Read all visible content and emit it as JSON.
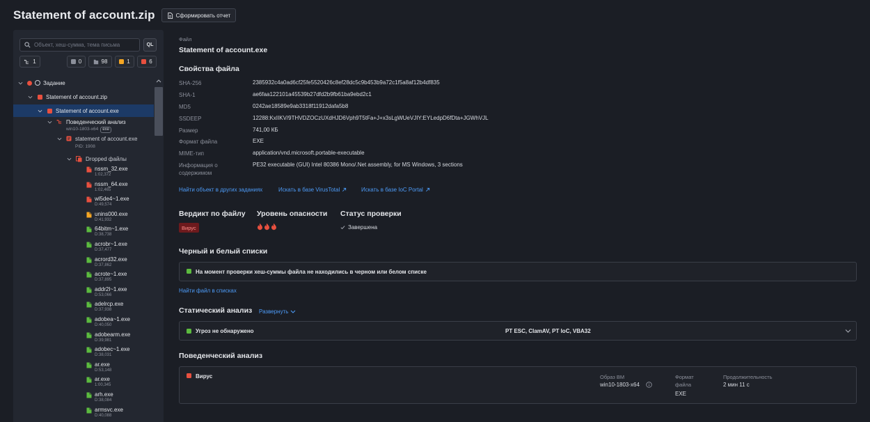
{
  "header": {
    "title": "Statement of account.zip",
    "report_button": "Сформировать отчет"
  },
  "sidebar": {
    "search_placeholder": "Объект, хеш-сумма, тема письма",
    "ql_label": "QL",
    "counters": {
      "tree": "1",
      "gray": "0",
      "files": "98",
      "orange": "1",
      "red": "6"
    },
    "tree": {
      "task": "Задание",
      "zip": "Statement of account.zip",
      "exe": "Statement of account.exe",
      "behavior": "Поведенческий анализ",
      "vm": "win10-1803-x64",
      "vm_badge": "exe",
      "process": "statement of account.exe",
      "pid": "PID: 1908",
      "dropped": "Dropped файлы"
    },
    "files": [
      {
        "name": "nssm_32.exe",
        "sub": "1:02,372",
        "color": "#e8503f"
      },
      {
        "name": "nssm_64.exe",
        "sub": "1:02,465",
        "color": "#e8503f"
      },
      {
        "name": "wl5de4~1.exe",
        "sub": "D:49,574",
        "color": "#e8503f"
      },
      {
        "name": "unins000.exe",
        "sub": "D:41,932",
        "color": "#f5a623"
      },
      {
        "name": "64bitm~1.exe",
        "sub": "D:38,738",
        "color": "#5cbb3f"
      },
      {
        "name": "acrobr~1.exe",
        "sub": "D:37,477",
        "color": "#5cbb3f"
      },
      {
        "name": "acrord32.exe",
        "sub": "D:37,862",
        "color": "#5cbb3f"
      },
      {
        "name": "acrote~1.exe",
        "sub": "D:37,895",
        "color": "#5cbb3f"
      },
      {
        "name": "addr2l~1.exe",
        "sub": "D:53,066",
        "color": "#5cbb3f"
      },
      {
        "name": "adelrcp.exe",
        "sub": "D:37,938",
        "color": "#5cbb3f"
      },
      {
        "name": "adobea~1.exe",
        "sub": "D:40,050",
        "color": "#5cbb3f"
      },
      {
        "name": "adobearm.exe",
        "sub": "D:39,981",
        "color": "#5cbb3f"
      },
      {
        "name": "adobec~1.exe",
        "sub": "D:38,031",
        "color": "#5cbb3f"
      },
      {
        "name": "ar.exe",
        "sub": "D:53,148",
        "color": "#5cbb3f"
      },
      {
        "name": "ar.exe",
        "sub": "1:00,345",
        "color": "#5cbb3f"
      },
      {
        "name": "arh.exe",
        "sub": "D:38,084",
        "color": "#5cbb3f"
      },
      {
        "name": "armsvc.exe",
        "sub": "D:40,088",
        "color": "#5cbb3f"
      }
    ]
  },
  "main": {
    "file_label": "Файл",
    "file_name": "Statement of account.exe",
    "props_title": "Свойства файла",
    "props": [
      {
        "key": "SHA-256",
        "value": "2385932c4a0ad6cf25fe5520426c8ef28dc5c9b453b9a72c1f5a8af12b4df835"
      },
      {
        "key": "SHA-1",
        "value": "ae6faa122101a45539b27dfd2b9fb61ba9ebd2c1"
      },
      {
        "key": "MD5",
        "value": "0242ae18589e9ab3318f11912dafa5b8"
      },
      {
        "key": "SSDEEP",
        "value": "12288:KxIIKV/9THVDZOCzUXdHJD6Vph9T5tFa+J+x3sLgWUeVJIY:EYLedpD6fDta+JGWhVJL"
      },
      {
        "key": "Размер",
        "value": "741,00 КБ"
      },
      {
        "key": "Формат файла",
        "value": "EXE"
      },
      {
        "key": "MIME-тип",
        "value": "application/vnd.microsoft.portable-executable"
      },
      {
        "key": "Информация о содержимом",
        "value": "PE32 executable (GUI) Intel 80386 Mono/.Net assembly, for MS Windows, 3 sections"
      }
    ],
    "links": {
      "find_other": "Найти объект в других заданиях",
      "virustotal": "Искать в базе VirusTotal",
      "ioc": "Искать в базе IoC Portal"
    },
    "verdict_title": "Вердикт по файлу",
    "danger_title": "Уровень опасности",
    "status_title": "Статус проверки",
    "verdict_value": "Вирус",
    "status_value": "Завершена",
    "bw_title": "Черный и белый списки",
    "bw_text": "На момент проверки хеш-суммы файла не находились в черном или белом списке",
    "find_in_lists": "Найти файл в списках",
    "static_title": "Статический анализ",
    "expand_label": "Развернуть",
    "static_text": "Угроз не обнаружено",
    "static_engines": "PT ESC, ClamAV, PT IoC, VBA32",
    "behavior_title": "Поведенческий анализ",
    "behavior_verdict": "Вирус",
    "vm_label": "Образ ВМ",
    "vm_value": "win10-1803-x64",
    "format_label_1": "Формат",
    "format_label_2": "файла",
    "format_value": "EXE",
    "duration_label": "Продолжительность",
    "duration_value": "2 мин 11 с"
  },
  "colors": {
    "accent": "#4d9bf7",
    "red": "#e8503f",
    "orange": "#f5a623",
    "green": "#5cbb3f",
    "selected": "#1c3a66"
  }
}
